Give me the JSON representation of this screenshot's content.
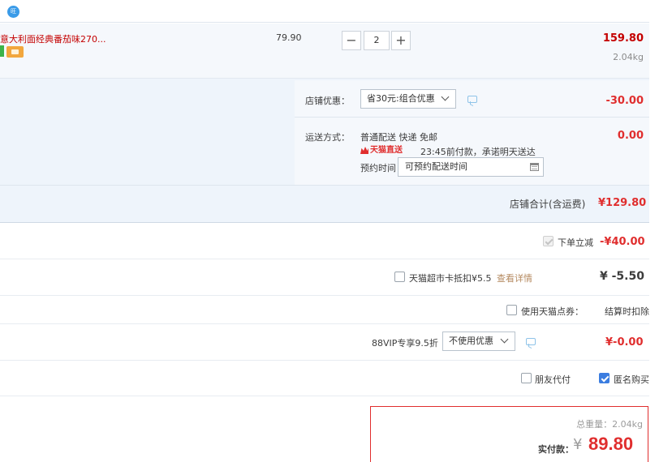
{
  "top": {
    "fragment": ""
  },
  "item": {
    "title": "意大利面经典番茄味270...",
    "unit_price": "79.90",
    "quantity": "2",
    "subtotal": "159.80",
    "weight": "2.04kg"
  },
  "shop": {
    "promo_label": "店铺优惠：",
    "promo_value": "省30元:组合优惠",
    "promo_amount": "-30.00",
    "shipping_label": "运送方式：",
    "shipping_method": "普通配送 快递 免邮",
    "shipping_amount": "0.00",
    "tmall_badge": "天猫直送",
    "delivery_promise": "23:45前付款，承诺明天送达",
    "appointment_label": "预约时间",
    "appointment_placeholder": "可预约配送时间",
    "total_label": "店铺合计(含运费)",
    "total_value": "¥129.80"
  },
  "discounts": {
    "order_discount_label": "下单立减",
    "order_discount_value": "-¥40.00",
    "supermarket_card_label": "天猫超市卡抵扣¥5.5",
    "supermarket_card_link": "查看详情",
    "supermarket_card_value": "¥ -5.50",
    "points_label": "使用天猫点券：",
    "points_value": "结算时扣除",
    "vip_label": "88VIP专享9.5折",
    "vip_select": "不使用优惠",
    "vip_value": "¥-0.00",
    "friend_pay_label": "朋友代付",
    "anonymous_label": "匿名购买"
  },
  "total": {
    "weight_label": "总重量：2.04kg",
    "pay_label": "实付款：",
    "currency": "¥",
    "amount": "89.80"
  },
  "colors": {
    "accent_red": "#e02e2e",
    "panel_blue": "#eef4fb",
    "check_blue": "#3b7de0"
  }
}
